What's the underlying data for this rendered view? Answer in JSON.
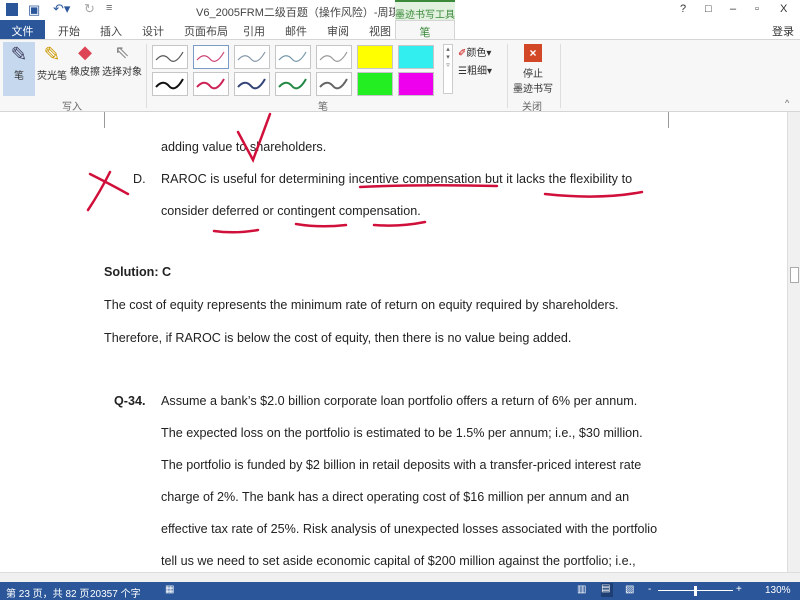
{
  "title": "V6_2005FRM二级百题（操作风险）-周琪 - Word",
  "contextual_tab_group": "墨迹书写工具",
  "window_controls": [
    "?",
    "□",
    "–",
    "▫",
    "X"
  ],
  "login": "登录",
  "tabs": [
    "文件",
    "开始",
    "插入",
    "设计",
    "页面布局",
    "引用",
    "邮件",
    "审阅",
    "视图",
    "笔"
  ],
  "ribbon": {
    "write_tools": [
      "笔",
      "荧光笔",
      "橡皮擦",
      "选择对象"
    ],
    "write_group": "写入",
    "pen_group": "笔",
    "color_label": "颜色",
    "thickness_label": "粗细",
    "stop_label_1": "停止",
    "stop_label_2": "墨迹书写",
    "close_group": "关闭",
    "pen_colors_row1": [
      "#555555",
      "#cc4477",
      "#8899aa",
      "#7799aa",
      "#999999",
      "#ffff00",
      "#33eeee"
    ],
    "pen_colors_row2": [
      "#111111",
      "#cc2255",
      "#334477",
      "#228844",
      "#666666",
      "#22ee22",
      "#ee00ee"
    ]
  },
  "document": {
    "lines": [
      "adding value to shareholders.",
      "D.",
      "RAROC is useful for determining incentive compensation but it lacks the flexibility to",
      "consider deferred or contingent compensation.",
      "Solution: C",
      "The cost of equity represents the minimum rate of return on equity required by shareholders.",
      "Therefore, if RAROC is below the cost of equity, then there is no value being added.",
      "Q-34.",
      "Assume a bank’s $2.0 billion corporate loan portfolio offers a return of 6% per annum.",
      "The expected loss on the portfolio is estimated to be 1.5% per annum; i.e., $30 million.",
      "The portfolio is funded by $2 billion in retail deposits with a transfer-priced interest rate",
      "charge of 2%. The bank has a direct operating cost of $16 million per annum and an",
      "effective tax rate of 25%. Risk analysis of unexpected losses associated with the portfolio",
      "tell us we need to set aside economic capital of $200 million against the portfolio; i.e.,"
    ],
    "ink_color": "#d0103a"
  },
  "status": {
    "page": "第 23 页，共 82 页",
    "words": "20357 个字",
    "zoom": "130%",
    "zoom_minus": "-",
    "zoom_plus": "+"
  }
}
